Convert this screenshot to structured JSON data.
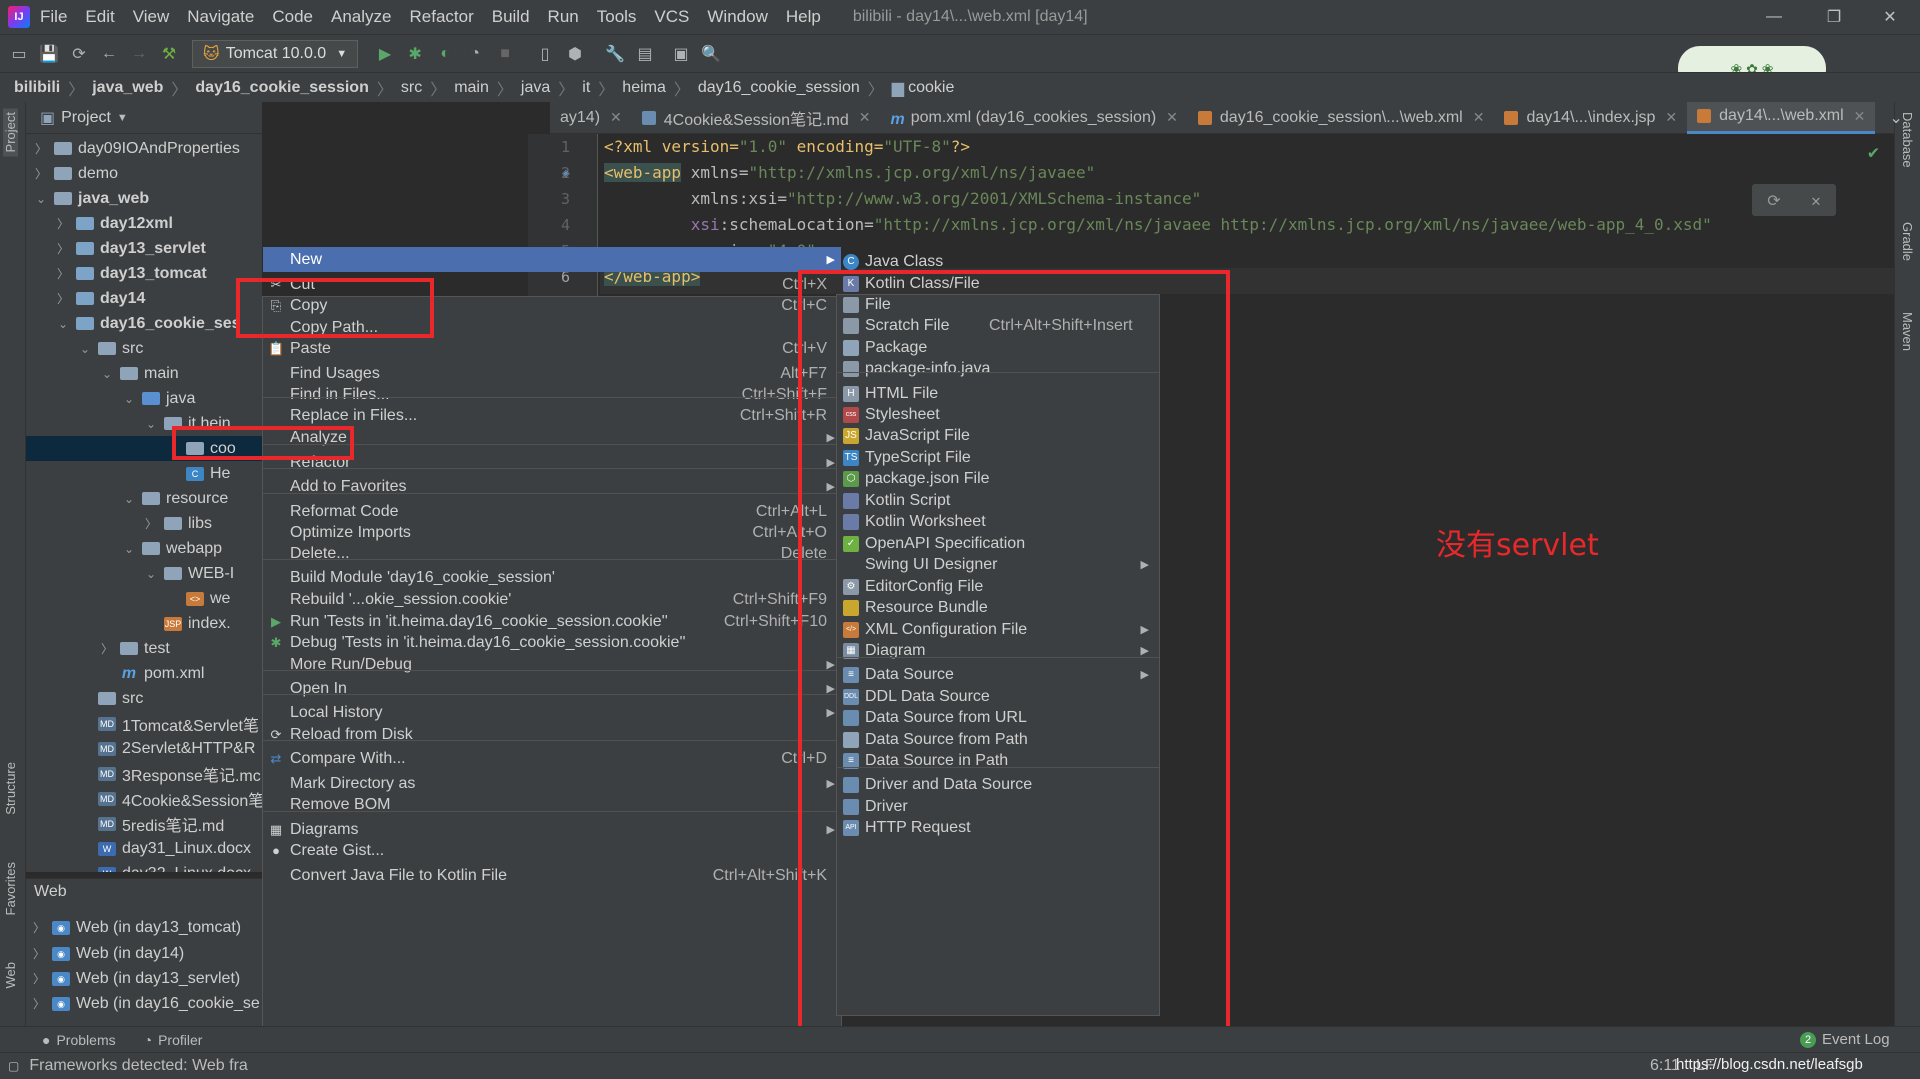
{
  "menubar": {
    "logo": "IJ",
    "items": [
      "File",
      "Edit",
      "View",
      "Navigate",
      "Code",
      "Analyze",
      "Refactor",
      "Build",
      "Run",
      "Tools",
      "VCS",
      "Window",
      "Help"
    ],
    "window_title": "bilibili - day14\\...\\web.xml [day14]"
  },
  "toolbar": {
    "run_config": "Tomcat 10.0.0"
  },
  "breadcrumb": [
    "bilibili",
    "java_web",
    "day16_cookie_session",
    "src",
    "main",
    "java",
    "it",
    "heima",
    "day16_cookie_session",
    "cookie"
  ],
  "project": {
    "title": "Project",
    "tree": [
      {
        "label": "day09IOAndProperties",
        "bold": false
      },
      {
        "label": "demo",
        "bold": false
      },
      {
        "label": "java_web",
        "bold": true
      },
      {
        "label": "day12xml",
        "bold": true
      },
      {
        "label": "day13_servlet",
        "bold": true
      },
      {
        "label": "day13_tomcat",
        "bold": true
      },
      {
        "label": "day14",
        "bold": true
      },
      {
        "label": "day16_cookie_ses",
        "bold": true
      },
      {
        "label": "src",
        "bold": false
      },
      {
        "label": "main",
        "bold": false
      },
      {
        "label": "java",
        "bold": false
      },
      {
        "label": "it.hein",
        "bold": false
      },
      {
        "label": "coo",
        "bold": false
      },
      {
        "label": "He",
        "bold": false
      },
      {
        "label": "resource",
        "bold": false
      },
      {
        "label": "libs",
        "bold": false
      },
      {
        "label": "webapp",
        "bold": false
      },
      {
        "label": "WEB-I",
        "bold": false
      },
      {
        "label": "we",
        "bold": false
      },
      {
        "label": "index.",
        "bold": false
      },
      {
        "label": "test",
        "bold": false
      },
      {
        "label": "pom.xml",
        "bold": false
      },
      {
        "label": "src",
        "bold": false
      },
      {
        "label": "1Tomcat&Servlet笔",
        "bold": false
      },
      {
        "label": "2Servlet&HTTP&R",
        "bold": false
      },
      {
        "label": "3Response笔记.mc",
        "bold": false
      },
      {
        "label": "4Cookie&Session笔",
        "bold": false
      },
      {
        "label": "5redis笔记.md",
        "bold": false
      },
      {
        "label": "day31_Linux.docx",
        "bold": false
      },
      {
        "label": "day32_Linux.docx",
        "bold": false
      }
    ]
  },
  "web_panel": {
    "title": "Web",
    "items": [
      "Web (in day13_tomcat)",
      "Web (in day14)",
      "Web (in day13_servlet)",
      "Web (in day16_cookie_se"
    ]
  },
  "left_strip": [
    "Project",
    "Structure",
    "Favorites",
    "Web"
  ],
  "right_strip": [
    "Database",
    "Gradle",
    "Maven"
  ],
  "tabs": [
    {
      "label": "ay14)",
      "icon": "xml"
    },
    {
      "label": "4Cookie&Session笔记.md",
      "icon": "md"
    },
    {
      "label": "pom.xml (day16_cookies_session)",
      "icon": "m"
    },
    {
      "label": "day16_cookie_session\\...\\web.xml",
      "icon": "xml"
    },
    {
      "label": "day14\\...\\index.jsp",
      "icon": "jsp"
    },
    {
      "label": "day14\\...\\web.xml",
      "icon": "xml"
    }
  ],
  "editor": {
    "line_numbers": [
      "1",
      "2",
      "3",
      "4",
      "5",
      "6"
    ],
    "lines": {
      "l1_a": "<?xml version=",
      "l1_b": "\"1.0\"",
      "l1_c": " encoding=",
      "l1_d": "\"UTF-8\"",
      "l1_e": "?>",
      "l2_tag": "<web-app",
      "l2_attr": " xmlns=",
      "l2_val": "\"http://xmlns.jcp.org/xml/ns/javaee\"",
      "l3_ns": "xmlns:xsi=",
      "l3_val": "\"http://www.w3.org/2001/XMLSchema-instance\"",
      "l4_ns": "xsi",
      "l4_attr": ":schemaLocation=",
      "l4_val": "\"http://xmlns.jcp.org/xml/ns/javaee http://xmlns.jcp.org/xml/ns/javaee/web-app_4_0.xsd\"",
      "l5_attr": "version=",
      "l5_val": "\"4.0\"",
      "l5_end": ">",
      "l6_tag": "</web-app>"
    }
  },
  "context_menu": [
    {
      "label": "New",
      "shortcut": "",
      "submenu": true,
      "highlighted": true
    },
    {
      "label": "Cut",
      "shortcut": "Ctrl+X",
      "icon": "✂"
    },
    {
      "label": "Copy",
      "shortcut": "Ctrl+C",
      "icon": "⎘"
    },
    {
      "label": "Copy Path...",
      "shortcut": ""
    },
    {
      "label": "Paste",
      "shortcut": "Ctrl+V",
      "icon": "📋"
    },
    {
      "label": "Find Usages",
      "shortcut": "Alt+F7"
    },
    {
      "label": "Find in Files...",
      "shortcut": "Ctrl+Shift+F"
    },
    {
      "label": "Replace in Files...",
      "shortcut": "Ctrl+Shift+R"
    },
    {
      "label": "Analyze",
      "shortcut": "",
      "submenu": true
    },
    {
      "label": "Refactor",
      "shortcut": "",
      "submenu": true
    },
    {
      "label": "Add to Favorites",
      "shortcut": "",
      "submenu": true
    },
    {
      "label": "Reformat Code",
      "shortcut": "Ctrl+Alt+L"
    },
    {
      "label": "Optimize Imports",
      "shortcut": "Ctrl+Alt+O"
    },
    {
      "label": "Delete...",
      "shortcut": "Delete"
    },
    {
      "label": "Build Module 'day16_cookie_session'",
      "shortcut": ""
    },
    {
      "label": "Rebuild '...okie_session.cookie'",
      "shortcut": "Ctrl+Shift+F9"
    },
    {
      "label": "Run 'Tests in 'it.heima.day16_cookie_session.cookie''",
      "shortcut": "Ctrl+Shift+F10",
      "icon": "▶"
    },
    {
      "label": "Debug 'Tests in 'it.heima.day16_cookie_session.cookie''",
      "shortcut": "",
      "icon": "✱"
    },
    {
      "label": "More Run/Debug",
      "shortcut": "",
      "submenu": true
    },
    {
      "label": "Open In",
      "shortcut": "",
      "submenu": true
    },
    {
      "label": "Local History",
      "shortcut": "",
      "submenu": true
    },
    {
      "label": "Reload from Disk",
      "shortcut": "",
      "icon": "⟳"
    },
    {
      "label": "Compare With...",
      "shortcut": "Ctrl+D",
      "icon": "⇄"
    },
    {
      "label": "Mark Directory as",
      "shortcut": "",
      "submenu": true
    },
    {
      "label": "Remove BOM",
      "shortcut": ""
    },
    {
      "label": "Diagrams",
      "shortcut": "",
      "submenu": true,
      "icon": "▦"
    },
    {
      "label": "Create Gist...",
      "shortcut": "",
      "icon": "●"
    },
    {
      "label": "Convert Java File to Kotlin File",
      "shortcut": "Ctrl+Alt+Shift+K"
    }
  ],
  "new_submenu": [
    {
      "label": "Java Class",
      "shortcut": "",
      "icon_color": "#3d86c6",
      "glyph": "C"
    },
    {
      "label": "Kotlin Class/File",
      "shortcut": "",
      "icon_color": "#6a7ba8",
      "glyph": "K"
    },
    {
      "label": "File",
      "shortcut": "",
      "icon_color": "#8a98a8",
      "glyph": ""
    },
    {
      "label": "Scratch File",
      "shortcut": "Ctrl+Alt+Shift+Insert",
      "icon_color": "#8a98a8",
      "glyph": ""
    },
    {
      "label": "Package",
      "shortcut": "",
      "icon_color": "#8fa4b8",
      "glyph": ""
    },
    {
      "label": "package-info.java",
      "shortcut": "",
      "icon_color": "#8a98a8",
      "glyph": ""
    },
    {
      "label": "HTML File",
      "shortcut": "",
      "icon_color": "#8a98a8",
      "glyph": "H"
    },
    {
      "label": "Stylesheet",
      "shortcut": "",
      "icon_color": "#b04a4a",
      "glyph": "css"
    },
    {
      "label": "JavaScript File",
      "shortcut": "",
      "icon_color": "#c9a72e",
      "glyph": "JS"
    },
    {
      "label": "TypeScript File",
      "shortcut": "",
      "icon_color": "#3d86c6",
      "glyph": "TS"
    },
    {
      "label": "package.json File",
      "shortcut": "",
      "icon_color": "#5a9a4a",
      "glyph": "⬡"
    },
    {
      "label": "Kotlin Script",
      "shortcut": "",
      "icon_color": "#6a7ba8",
      "glyph": ""
    },
    {
      "label": "Kotlin Worksheet",
      "shortcut": "",
      "icon_color": "#6a7ba8",
      "glyph": ""
    },
    {
      "label": "OpenAPI Specification",
      "shortcut": "",
      "icon_color": "#6fb043",
      "glyph": "✓"
    },
    {
      "label": "Swing UI Designer",
      "shortcut": "",
      "submenu": true,
      "icon_color": "",
      "glyph": ""
    },
    {
      "label": "EditorConfig File",
      "shortcut": "",
      "icon_color": "#8a98a8",
      "glyph": "⚙"
    },
    {
      "label": "Resource Bundle",
      "shortcut": "",
      "icon_color": "#c9a72e",
      "glyph": ""
    },
    {
      "label": "XML Configuration File",
      "shortcut": "",
      "submenu": true,
      "icon_color": "#c77a3a",
      "glyph": "</>"
    },
    {
      "label": "Diagram",
      "shortcut": "",
      "submenu": true,
      "icon_color": "#7a8ca0",
      "glyph": "▦"
    },
    {
      "label": "Data Source",
      "shortcut": "",
      "submenu": true,
      "icon_color": "#6a8cb0",
      "glyph": "≡"
    },
    {
      "label": "DDL Data Source",
      "shortcut": "",
      "icon_color": "#6a8cb0",
      "glyph": "DDL"
    },
    {
      "label": "Data Source from URL",
      "shortcut": "",
      "icon_color": "#6a8cb0",
      "glyph": ""
    },
    {
      "label": "Data Source from Path",
      "shortcut": "",
      "icon_color": "#8fa4b8",
      "glyph": ""
    },
    {
      "label": "Data Source in Path",
      "shortcut": "",
      "icon_color": "#6a8cb0",
      "glyph": "≡"
    },
    {
      "label": "Driver and Data Source",
      "shortcut": "",
      "icon_color": "#6a8cb0",
      "glyph": ""
    },
    {
      "label": "Driver",
      "shortcut": "",
      "icon_color": "#6a8cb0",
      "glyph": ""
    },
    {
      "label": "HTTP Request",
      "shortcut": "",
      "icon_color": "#6a8cb0",
      "glyph": "API"
    }
  ],
  "annotation": "没有servlet",
  "bottom_tabs": [
    "Problems",
    "Profiler"
  ],
  "event_log": {
    "count": "2",
    "label": "Event Log"
  },
  "status": {
    "message": "Frameworks detected: Web fra",
    "position": "6:11",
    "line_sep": "LF",
    "watermark": "https://blog.csdn.net/leafsgb"
  },
  "colors": {
    "bg": "#2b2b2b",
    "panel": "#3c3f41",
    "menu_highlight": "#4b6eaf",
    "annotation_red": "#e8282b",
    "xml_tag": "#e8bf6a",
    "xml_value": "#6a8759"
  }
}
